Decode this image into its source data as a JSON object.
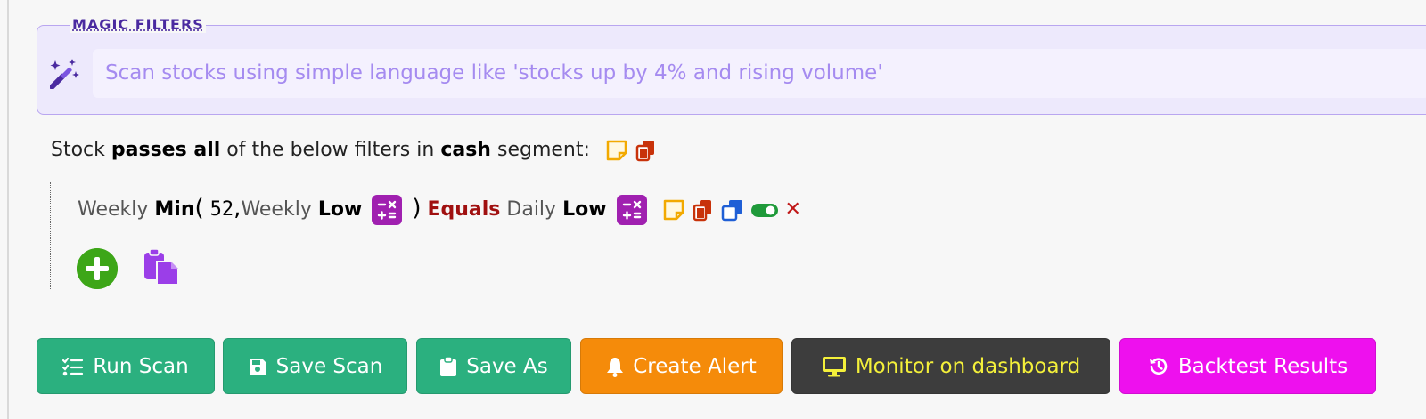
{
  "magic": {
    "title": "MAGIC FILTERS",
    "placeholder": "Scan stocks using simple language like 'stocks up by 4% and rising volume'"
  },
  "segment": {
    "prefix": "Stock",
    "mode": "passes all",
    "middle": "of the below filters in",
    "segment": "cash",
    "suffix": "segment:"
  },
  "filter": {
    "lhs_timeframe": "Weekly",
    "func": "Min",
    "open_paren": "(",
    "arg_num": "52",
    "comma": ",",
    "arg_timeframe": "Weekly",
    "arg_field": "Low",
    "close_paren": ")",
    "operator": "Equals",
    "rhs_timeframe": "Daily",
    "rhs_field": "Low",
    "remove": "✕"
  },
  "buttons": {
    "run": "Run Scan",
    "save": "Save Scan",
    "save_as": "Save As",
    "alert": "Create Alert",
    "monitor": "Monitor on dashboard",
    "backtest": "Backtest Results"
  },
  "colors": {
    "green_btn": "#2bb07f",
    "orange_btn": "#f58b0a",
    "dark_btn": "#3d3d3d",
    "magenta_btn": "#ee10ee",
    "monitor_text": "#f4f03a"
  }
}
